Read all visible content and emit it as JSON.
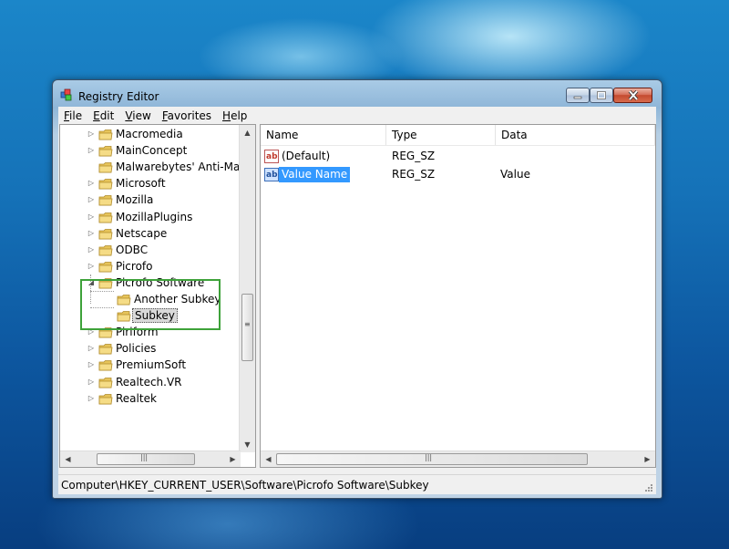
{
  "window": {
    "title": "Registry Editor"
  },
  "menu": {
    "items": [
      "File",
      "Edit",
      "View",
      "Favorites",
      "Help"
    ]
  },
  "tree": {
    "items": [
      {
        "label": "Macromedia",
        "expander": "▷"
      },
      {
        "label": "MainConcept",
        "expander": "▷"
      },
      {
        "label": "Malwarebytes' Anti-Malw",
        "expander": ""
      },
      {
        "label": "Microsoft",
        "expander": "▷"
      },
      {
        "label": "Mozilla",
        "expander": "▷"
      },
      {
        "label": "MozillaPlugins",
        "expander": "▷"
      },
      {
        "label": "Netscape",
        "expander": "▷"
      },
      {
        "label": "ODBC",
        "expander": "▷"
      },
      {
        "label": "Picrofo",
        "expander": "▷"
      },
      {
        "label": "Picrofo Software",
        "expander": "◢"
      },
      {
        "label": "Another Subkey",
        "expander": ""
      },
      {
        "label": "Subkey",
        "expander": ""
      },
      {
        "label": "Piriform",
        "expander": "▷"
      },
      {
        "label": "Policies",
        "expander": "▷"
      },
      {
        "label": "PremiumSoft",
        "expander": "▷"
      },
      {
        "label": "Realtech.VR",
        "expander": "▷"
      },
      {
        "label": "Realtek",
        "expander": "▷"
      }
    ],
    "selected": "Subkey"
  },
  "list": {
    "columns": [
      "Name",
      "Type",
      "Data"
    ],
    "rows": [
      {
        "name": "(Default)",
        "type": "REG_SZ",
        "data": ""
      },
      {
        "name": "Value Name",
        "type": "REG_SZ",
        "data": "Value"
      }
    ],
    "icon_text": "ab"
  },
  "status": {
    "path": "Computer\\HKEY_CURRENT_USER\\Software\\Picrofo Software\\Subkey"
  },
  "colors": {
    "highlight_box": "#3ea23a",
    "selection": "#3399ff"
  }
}
